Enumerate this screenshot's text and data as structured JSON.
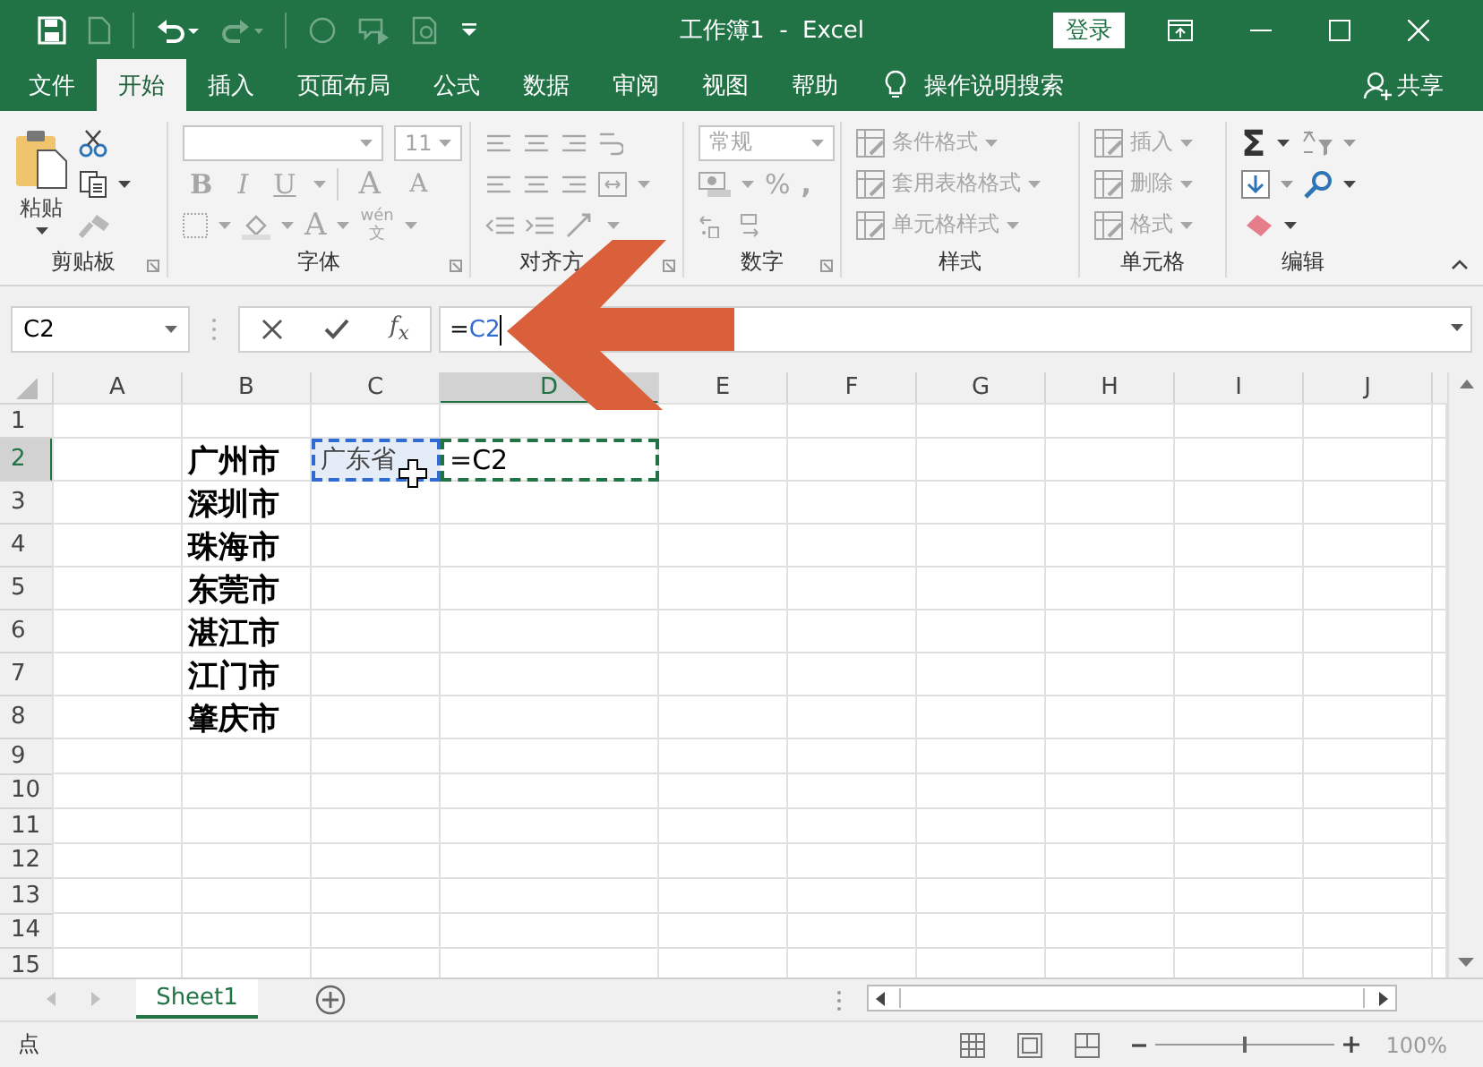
{
  "window": {
    "title": "工作簿1  -  Excel",
    "login_button": "登录"
  },
  "ribbon_tabs": [
    {
      "label": "文件",
      "selected": false
    },
    {
      "label": "开始",
      "selected": true
    },
    {
      "label": "插入",
      "selected": false
    },
    {
      "label": "页面布局",
      "selected": false
    },
    {
      "label": "公式",
      "selected": false
    },
    {
      "label": "数据",
      "selected": false
    },
    {
      "label": "审阅",
      "selected": false
    },
    {
      "label": "视图",
      "selected": false
    },
    {
      "label": "帮助",
      "selected": false
    }
  ],
  "tell_me": "操作说明搜索",
  "share": "共享",
  "ribbon": {
    "clipboard": {
      "label": "剪贴板",
      "paste": "粘贴"
    },
    "font": {
      "label": "字体",
      "disabled": true,
      "size": "11",
      "style_buttons": [
        "B",
        "I",
        "U"
      ],
      "size_buttons": [
        "A",
        "A"
      ],
      "font_color": "A",
      "phonetic_top": "wén",
      "phonetic_bottom": "文"
    },
    "alignment": {
      "label": "对齐方",
      "disabled": true
    },
    "number": {
      "label": "数字",
      "disabled": true,
      "format": "常规",
      "percent": "%",
      "comma": ","
    },
    "styles": {
      "label": "样式",
      "commands": [
        {
          "label": "条件格式",
          "disabled": true
        },
        {
          "label": "套用表格格式",
          "disabled": true
        },
        {
          "label": "单元格样式",
          "disabled": true
        }
      ]
    },
    "cells": {
      "label": "单元格",
      "commands": [
        {
          "label": "插入",
          "disabled": true
        },
        {
          "label": "删除",
          "disabled": true
        },
        {
          "label": "格式",
          "disabled": true
        }
      ]
    },
    "editing": {
      "label": "编辑",
      "sum": "Σ"
    }
  },
  "formula_bar": {
    "name_box": "C2",
    "function_label": "f$_{x}$",
    "prefix": "=",
    "reference": "C2"
  },
  "columns": [
    {
      "label": "A",
      "selected": false
    },
    {
      "label": "B",
      "selected": false
    },
    {
      "label": "C",
      "selected": false
    },
    {
      "label": "D",
      "selected": true
    },
    {
      "label": "E",
      "selected": false
    },
    {
      "label": "F",
      "selected": false
    },
    {
      "label": "G",
      "selected": false
    },
    {
      "label": "H",
      "selected": false
    },
    {
      "label": "I",
      "selected": false
    },
    {
      "label": "J",
      "selected": false
    }
  ],
  "rows": [
    {
      "header": "1",
      "selected": false
    },
    {
      "header": "2",
      "selected": true,
      "col_b": {
        "text": "广州市",
        "kind": "city"
      },
      "col_c": {
        "text": "广东省",
        "kind": "referenced"
      },
      "col_d": {
        "text": "=C2",
        "kind": "editing"
      }
    },
    {
      "header": "3",
      "selected": false,
      "col_b": {
        "text": "深圳市",
        "kind": "city"
      }
    },
    {
      "header": "4",
      "selected": false,
      "col_b": {
        "text": "珠海市",
        "kind": "city"
      }
    },
    {
      "header": "5",
      "selected": false,
      "col_b": {
        "text": "东莞市",
        "kind": "city"
      }
    },
    {
      "header": "6",
      "selected": false,
      "col_b": {
        "text": "湛江市",
        "kind": "city"
      }
    },
    {
      "header": "7",
      "selected": false,
      "col_b": {
        "text": "江门市",
        "kind": "city"
      }
    },
    {
      "header": "8",
      "selected": false,
      "col_b": {
        "text": "肇庆市",
        "kind": "city"
      }
    },
    {
      "header": "9",
      "selected": false
    },
    {
      "header": "10",
      "selected": false
    },
    {
      "header": "11",
      "selected": false
    },
    {
      "header": "12",
      "selected": false
    },
    {
      "header": "13",
      "selected": false
    },
    {
      "header": "14",
      "selected": false
    },
    {
      "header": "15",
      "selected": false
    }
  ],
  "sheet_tabs": [
    {
      "label": "Sheet1",
      "selected": true
    }
  ],
  "status_bar": {
    "mode": "点",
    "zoom": "100%",
    "zoom_slider": {
      "level": 0.5
    }
  }
}
